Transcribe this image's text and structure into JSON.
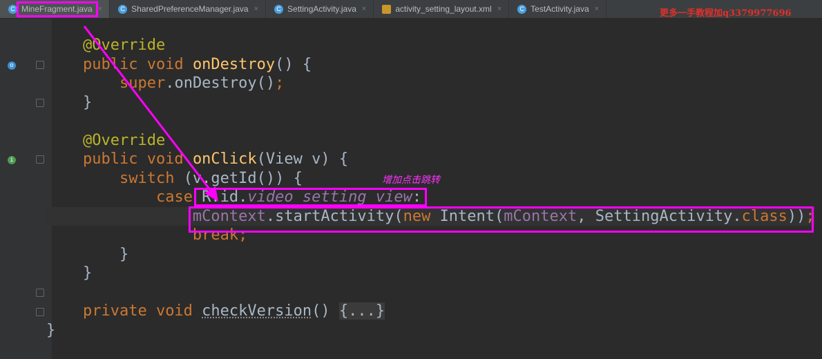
{
  "tabs": [
    {
      "label": "MineFragment.java",
      "icon": "class-icon",
      "active": true
    },
    {
      "label": "SharedPreferenceManager.java",
      "icon": "class-icon"
    },
    {
      "label": "SettingActivity.java",
      "icon": "class-icon"
    },
    {
      "label": "activity_setting_layout.xml",
      "icon": "xml-icon"
    },
    {
      "label": "TestActivity.java",
      "icon": "class-icon"
    }
  ],
  "watermark": "更多一手教程加q3379977696",
  "annotation": "增加点击跳转",
  "colors": {
    "highlight": "#ff00ff",
    "keyword": "#cc7832",
    "background": "#2b2b2b"
  },
  "code": [
    [
      [
        "    @Override",
        "ann"
      ]
    ],
    [
      [
        "    "
      ],
      [
        "public void ",
        "kw"
      ],
      [
        "onDestroy",
        "fn"
      ],
      [
        "() {"
      ]
    ],
    [
      [
        "        "
      ],
      [
        "super",
        "kw"
      ],
      [
        ".onDestroy()"
      ],
      [
        ";",
        "kw"
      ]
    ],
    [
      [
        "    }"
      ]
    ],
    [],
    [
      [
        "    @Override",
        "ann"
      ]
    ],
    [
      [
        "    "
      ],
      [
        "public void ",
        "kw"
      ],
      [
        "onClick",
        "fn"
      ],
      [
        "(View v) {"
      ]
    ],
    [
      [
        "        "
      ],
      [
        "switch ",
        "kw"
      ],
      [
        "(v.getId()) {"
      ]
    ],
    [
      [
        "            "
      ],
      [
        "case ",
        "kw"
      ],
      [
        "R.id."
      ],
      [
        "video_setting_view",
        "it"
      ],
      [
        ":"
      ]
    ],
    [
      [
        "                "
      ],
      [
        "mContext",
        "fld"
      ],
      [
        ".startActivity("
      ],
      [
        "new ",
        "kw"
      ],
      [
        "Intent("
      ],
      [
        "mContext",
        "fld"
      ],
      [
        ", "
      ],
      [
        "SettingActivity."
      ],
      [
        "class",
        "kw"
      ],
      [
        "))"
      ],
      [
        ";",
        "kw"
      ]
    ],
    [
      [
        "                "
      ],
      [
        "break;",
        "kw"
      ]
    ],
    [
      [
        "        }"
      ]
    ],
    [
      [
        "    }"
      ]
    ],
    [],
    [
      [
        "    "
      ],
      [
        "private void ",
        "kw"
      ],
      [
        "checkVersion",
        "ul"
      ],
      [
        "() "
      ],
      [
        "{...}",
        "fold"
      ]
    ],
    [
      [
        "}"
      ]
    ]
  ]
}
